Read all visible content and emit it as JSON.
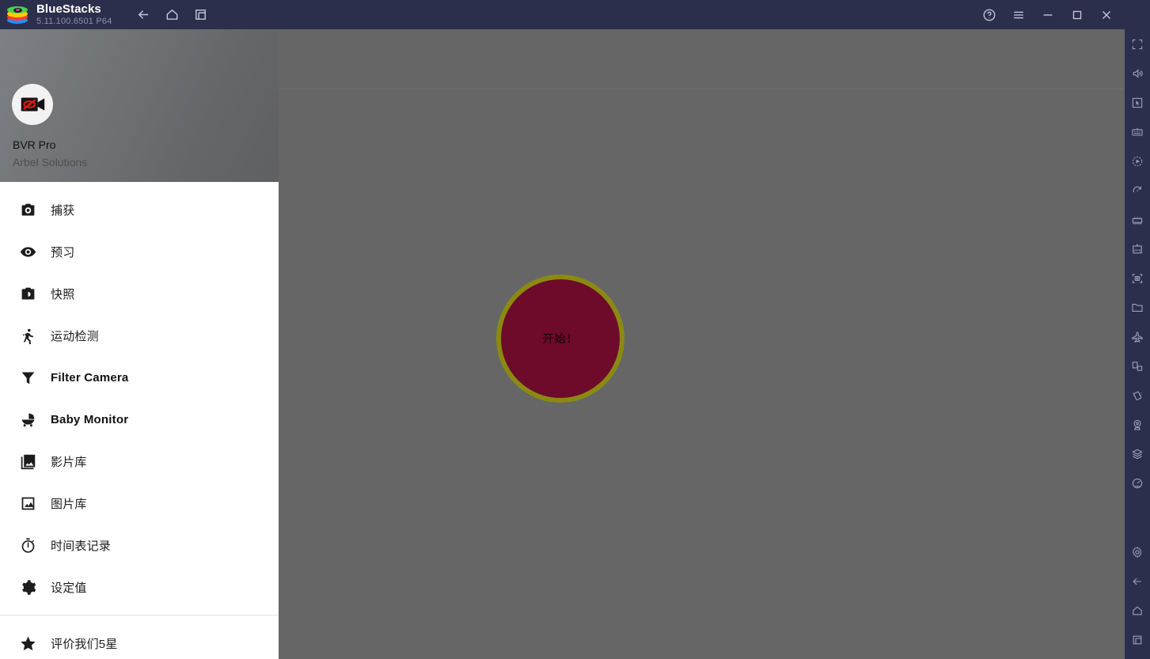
{
  "titlebar": {
    "app_name": "BlueStacks",
    "version": "5.11.100.6501 P64",
    "logo_icon": "bluestacks-logo",
    "nav_buttons": [
      {
        "name": "back-button",
        "icon": "arrow-left-icon"
      },
      {
        "name": "home-button",
        "icon": "home-icon"
      },
      {
        "name": "multi-instance-button",
        "icon": "windows-stack-icon"
      }
    ],
    "window_buttons": [
      {
        "name": "help-button",
        "icon": "question-circle-icon"
      },
      {
        "name": "menu-button",
        "icon": "hamburger-icon"
      },
      {
        "name": "minimize-button",
        "icon": "minimize-icon"
      },
      {
        "name": "maximize-button",
        "icon": "maximize-icon"
      },
      {
        "name": "close-button",
        "icon": "close-icon"
      },
      {
        "name": "collapse-sidebar-button",
        "icon": "chevrons-left-icon"
      }
    ]
  },
  "drawer": {
    "app_icon": "video-camera-disabled-icon",
    "app_title": "BVR Pro",
    "app_developer": "Arbel Solutions",
    "menu_items": [
      {
        "label": "捕获",
        "icon": "camera-icon",
        "bold": false
      },
      {
        "label": "预习",
        "icon": "eye-icon",
        "bold": false
      },
      {
        "label": "快照",
        "icon": "photo-camera-icon",
        "bold": false
      },
      {
        "label": "运动检测",
        "icon": "running-person-icon",
        "bold": false
      },
      {
        "label": "Filter Camera",
        "icon": "funnel-filter-icon",
        "bold": true
      },
      {
        "label": "Baby Monitor",
        "icon": "stroller-icon",
        "bold": true
      },
      {
        "label": "影片库",
        "icon": "video-library-icon",
        "bold": false
      },
      {
        "label": "图片库",
        "icon": "photo-library-icon",
        "bold": false
      },
      {
        "label": "时间表记录",
        "icon": "stopwatch-icon",
        "bold": false
      },
      {
        "label": "设定值",
        "icon": "gear-icon",
        "bold": false
      }
    ],
    "footer_item": {
      "label": "评价我们5星",
      "icon": "star-icon"
    }
  },
  "main": {
    "start_button_label": "开始！",
    "start_button_fill": "#6e0a2a",
    "start_button_border": "#8a8a12",
    "background_color": "#666666"
  },
  "sidebar": {
    "top_buttons": [
      {
        "name": "fullscreen-button",
        "icon": "fullscreen-icon"
      },
      {
        "name": "volume-button",
        "icon": "speaker-icon"
      },
      {
        "name": "cursor-control-button",
        "icon": "cursor-frame-icon"
      },
      {
        "name": "keyboard-controls-button",
        "icon": "keyboard-icon"
      },
      {
        "name": "macro-recorder-button",
        "icon": "play-circle-icon"
      },
      {
        "name": "rotate-button",
        "icon": "rotate-icon"
      },
      {
        "name": "game-controls-button",
        "icon": "gamepad-icon"
      },
      {
        "name": "install-apk-button",
        "icon": "apk-icon"
      },
      {
        "name": "screenshot-button",
        "icon": "screenshot-icon"
      },
      {
        "name": "media-manager-button",
        "icon": "folder-icon"
      },
      {
        "name": "eco-mode-button",
        "icon": "airplane-icon"
      },
      {
        "name": "multi-instance-sync-button",
        "icon": "instance-sync-icon"
      },
      {
        "name": "shake-button",
        "icon": "shake-icon"
      },
      {
        "name": "location-button",
        "icon": "location-pin-icon"
      },
      {
        "name": "layers-button",
        "icon": "layers-icon"
      },
      {
        "name": "performance-button",
        "icon": "gauge-icon"
      }
    ],
    "bottom_buttons": [
      {
        "name": "settings-button",
        "icon": "gear-icon"
      },
      {
        "name": "android-back-button",
        "icon": "arrow-left-icon"
      },
      {
        "name": "android-home-button",
        "icon": "home-icon"
      },
      {
        "name": "recent-apps-button",
        "icon": "recent-apps-icon"
      }
    ]
  }
}
